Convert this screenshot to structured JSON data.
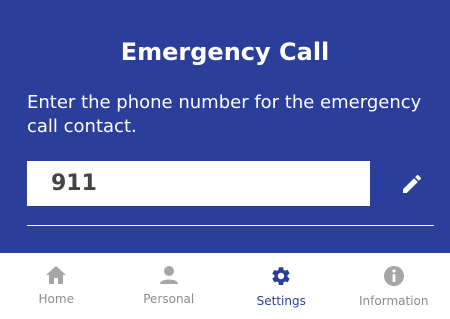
{
  "header": {
    "title": "Emergency Call",
    "description": "Enter the phone number for the emergency call contact."
  },
  "phone": {
    "value": "911"
  },
  "tabs": [
    {
      "label": "Home",
      "icon": "home-icon",
      "active": false
    },
    {
      "label": "Personal",
      "icon": "person-icon",
      "active": false
    },
    {
      "label": "Settings",
      "icon": "gear-icon",
      "active": true
    },
    {
      "label": "Information",
      "icon": "info-icon",
      "active": false
    }
  ],
  "colors": {
    "primary": "#2b3f9a",
    "inactive": "#a6a6a6"
  }
}
